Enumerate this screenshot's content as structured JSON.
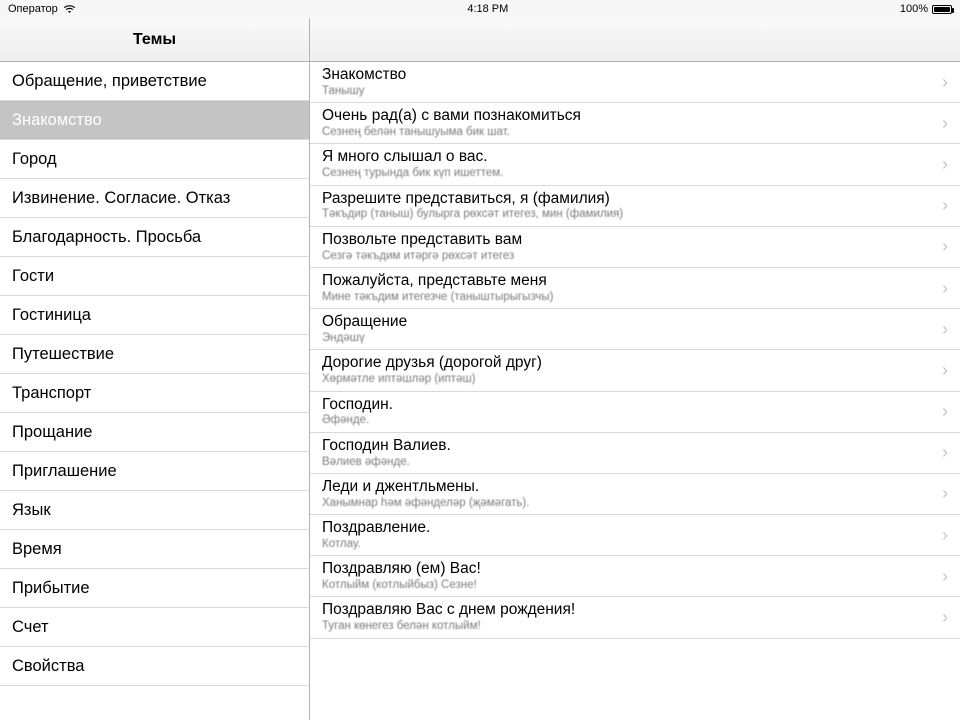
{
  "status": {
    "carrier": "Оператор",
    "time": "4:18 PM",
    "battery_pct": "100%"
  },
  "nav": {
    "sidebar_title": "Темы"
  },
  "sidebar": {
    "items": [
      {
        "label": "Обращение, приветствие",
        "selected": false
      },
      {
        "label": "Знакомство",
        "selected": true
      },
      {
        "label": "Город",
        "selected": false
      },
      {
        "label": "Извинение. Согласие. Отказ",
        "selected": false
      },
      {
        "label": "Благодарность. Просьба",
        "selected": false
      },
      {
        "label": "Гости",
        "selected": false
      },
      {
        "label": "Гостиница",
        "selected": false
      },
      {
        "label": "Путешествие",
        "selected": false
      },
      {
        "label": "Транспорт",
        "selected": false
      },
      {
        "label": "Прощание",
        "selected": false
      },
      {
        "label": "Приглашение",
        "selected": false
      },
      {
        "label": "Язык",
        "selected": false
      },
      {
        "label": "Время",
        "selected": false
      },
      {
        "label": "Прибытие",
        "selected": false
      },
      {
        "label": "Счет",
        "selected": false
      },
      {
        "label": "Свойства",
        "selected": false
      }
    ]
  },
  "phrases": [
    {
      "title": "Знакомство",
      "sub": "Танышу"
    },
    {
      "title": "Очень рад(а) с вами познакомиться",
      "sub": "Сезнең белән танышуыма бик шат."
    },
    {
      "title": "Я много слышал о вас.",
      "sub": "Сезнең турында бик күп ишеттем."
    },
    {
      "title": "Разрешите представиться, я (фамилия)",
      "sub": "Тәкъдир (таныш) булырга рөхсәт итегез, мин (фамилия)"
    },
    {
      "title": "Позвольте представить вам",
      "sub": "Сезгә тәкъдим итәргә рөхсәт итегез"
    },
    {
      "title": "Пожалуйста, представьте меня",
      "sub": "Мине тәкъдим итегезче (таныштырыгызчы)"
    },
    {
      "title": "Обращение",
      "sub": "Эндәшү"
    },
    {
      "title": "Дорогие друзья (дорогой друг)",
      "sub": "Хөрмәтле иптәшләр (иптәш)"
    },
    {
      "title": "Господин.",
      "sub": "Әфәнде."
    },
    {
      "title": "Господин Валиев.",
      "sub": "Вәлиев әфәнде."
    },
    {
      "title": "Леди и джентльмены.",
      "sub": "Ханымнар һәм әфәнделәр (җәмәгать)."
    },
    {
      "title": "Поздравление.",
      "sub": "Котлау."
    },
    {
      "title": "Поздравляю (ем) Вас!",
      "sub": "Котлыйм (котлыйбыз) Сезне!"
    },
    {
      "title": "Поздравляю Вас с днем рождения!",
      "sub": "Туган көнегез белән котлыйм!"
    }
  ]
}
